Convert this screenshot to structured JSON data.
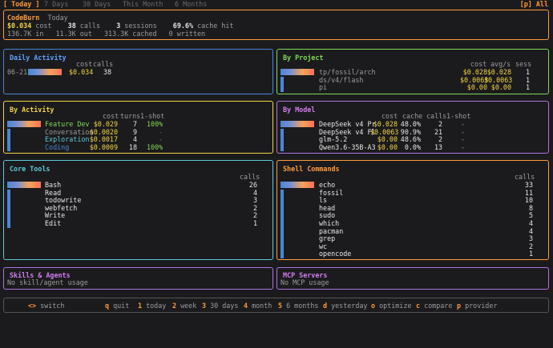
{
  "tabs": [
    "[ Today ]",
    "7 Days",
    "30 Days",
    "This Month",
    "6 Months"
  ],
  "provider_label": "[p] All",
  "header": {
    "title": "CodeBurn",
    "period": "Today",
    "cost": "$0.034",
    "cost_label": "cost",
    "calls": "38",
    "calls_label": "calls",
    "sessions": "3",
    "sessions_label": "sessions",
    "cache_hit": "69.6%",
    "cache_hit_label": "cache hit",
    "tokens_line": "136.7K in   11.3K out   313.3K cached   0 written"
  },
  "daily": {
    "title": "Daily Activity",
    "col_cost": "cost",
    "col_calls": "calls",
    "rows": [
      {
        "date": "06-21",
        "cost": "$0.034",
        "calls": "38",
        "fill": 1.0
      }
    ]
  },
  "project": {
    "title": "By Project",
    "col_cost": "cost",
    "col_avg": "avg/s",
    "col_sess": "sess",
    "rows": [
      {
        "name": "tp/fossil/arch",
        "cost": "$0.028",
        "avg": "$0.028",
        "sess": "1",
        "fill": 1.0
      },
      {
        "name": "ds/v4/flash",
        "cost": "$0.0063",
        "avg": "$0.0063",
        "sess": "1",
        "fill": 0.22
      },
      {
        "name": "pi",
        "cost": "$0.00",
        "avg": "$0.00",
        "sess": "1",
        "fill": 0.05
      }
    ]
  },
  "activity": {
    "title": "By Activity",
    "col_cost": "cost",
    "col_turns": "turns",
    "col_oneshot": "1-shot",
    "rows": [
      {
        "name": "Feature Dev",
        "cost": "$0.029",
        "turns": "7",
        "oneshot": "100%",
        "fill": 1.0,
        "color": "#7ed957"
      },
      {
        "name": "Conversation",
        "cost": "$0.0020",
        "turns": "9",
        "oneshot": "-",
        "fill": 0.07,
        "color": "#9c9c9c"
      },
      {
        "name": "Exploration",
        "cost": "$0.0017",
        "turns": "4",
        "oneshot": "-",
        "fill": 0.06,
        "color": "#5ec8d8"
      },
      {
        "name": "Coding",
        "cost": "$0.0009",
        "turns": "18",
        "oneshot": "100%",
        "fill": 0.03,
        "color": "#4a86d8"
      }
    ]
  },
  "model": {
    "title": "By Model",
    "col_cost": "cost",
    "col_cache": "cache",
    "col_calls": "calls",
    "col_oneshot": "1-shot",
    "rows": [
      {
        "name": "DeepSeek v4 Pr",
        "cost": "$0.028",
        "cache": "48.0%",
        "calls": "2",
        "oneshot": "-",
        "fill": 1.0
      },
      {
        "name": "DeepSeek v4 Fl",
        "cost": "$0.0063",
        "cache": "90.9%",
        "calls": "21",
        "oneshot": "-",
        "fill": 0.22
      },
      {
        "name": "glm-5.2",
        "cost": "$0.00",
        "cache": "48.6%",
        "calls": "2",
        "oneshot": "-",
        "fill": 0.05
      },
      {
        "name": "Qwen3.6-35B-A3",
        "cost": "$0.00",
        "cache": "0.0%",
        "calls": "13",
        "oneshot": "-",
        "fill": 0.05
      }
    ]
  },
  "tools": {
    "title": "Core Tools",
    "col_calls": "calls",
    "rows": [
      {
        "name": "Bash",
        "calls": "26",
        "fill": 1.0
      },
      {
        "name": "Read",
        "calls": "4",
        "fill": 0.15
      },
      {
        "name": "todowrite",
        "calls": "3",
        "fill": 0.12
      },
      {
        "name": "webfetch",
        "calls": "2",
        "fill": 0.08
      },
      {
        "name": "Write",
        "calls": "2",
        "fill": 0.08
      },
      {
        "name": "Edit",
        "calls": "1",
        "fill": 0.04
      }
    ]
  },
  "shell": {
    "title": "Shell Commands",
    "col_calls": "calls",
    "rows": [
      {
        "name": "echo",
        "calls": "33",
        "fill": 1.0
      },
      {
        "name": "fossil",
        "calls": "11",
        "fill": 0.33
      },
      {
        "name": "ls",
        "calls": "10",
        "fill": 0.3
      },
      {
        "name": "head",
        "calls": "8",
        "fill": 0.24
      },
      {
        "name": "sudo",
        "calls": "5",
        "fill": 0.15
      },
      {
        "name": "which",
        "calls": "4",
        "fill": 0.12
      },
      {
        "name": "pacman",
        "calls": "4",
        "fill": 0.12
      },
      {
        "name": "grep",
        "calls": "3",
        "fill": 0.09
      },
      {
        "name": "wc",
        "calls": "2",
        "fill": 0.06
      },
      {
        "name": "opencode",
        "calls": "1",
        "fill": 0.03
      }
    ]
  },
  "skills": {
    "title": "Skills & Agents",
    "empty": "No skill/agent usage"
  },
  "mcp": {
    "title": "MCP Servers",
    "empty": "No MCP usage"
  },
  "footer": [
    {
      "key": "<>",
      "label": "switch"
    },
    {
      "key": "q",
      "label": "quit"
    },
    {
      "key": "1",
      "label": "today"
    },
    {
      "key": "2",
      "label": "week"
    },
    {
      "key": "3",
      "label": "30 days"
    },
    {
      "key": "4",
      "label": "month"
    },
    {
      "key": "5",
      "label": "6 months"
    },
    {
      "key": "d",
      "label": "yesterday"
    },
    {
      "key": "o",
      "label": "optimize"
    },
    {
      "key": "c",
      "label": "compare"
    },
    {
      "key": "p",
      "label": "provider"
    }
  ],
  "colors": {
    "accent": "#ff9a3c",
    "summary_border": "#ff9a3c",
    "daily_border": "#4a86d8",
    "project_border": "#7ed957",
    "activity_border": "#f3d342",
    "model_border": "#b072e0",
    "tools_border": "#5ec8d8",
    "shell_border": "#ff9a3c",
    "skills_border": "#b072e0",
    "mcp_border": "#b072e0"
  }
}
